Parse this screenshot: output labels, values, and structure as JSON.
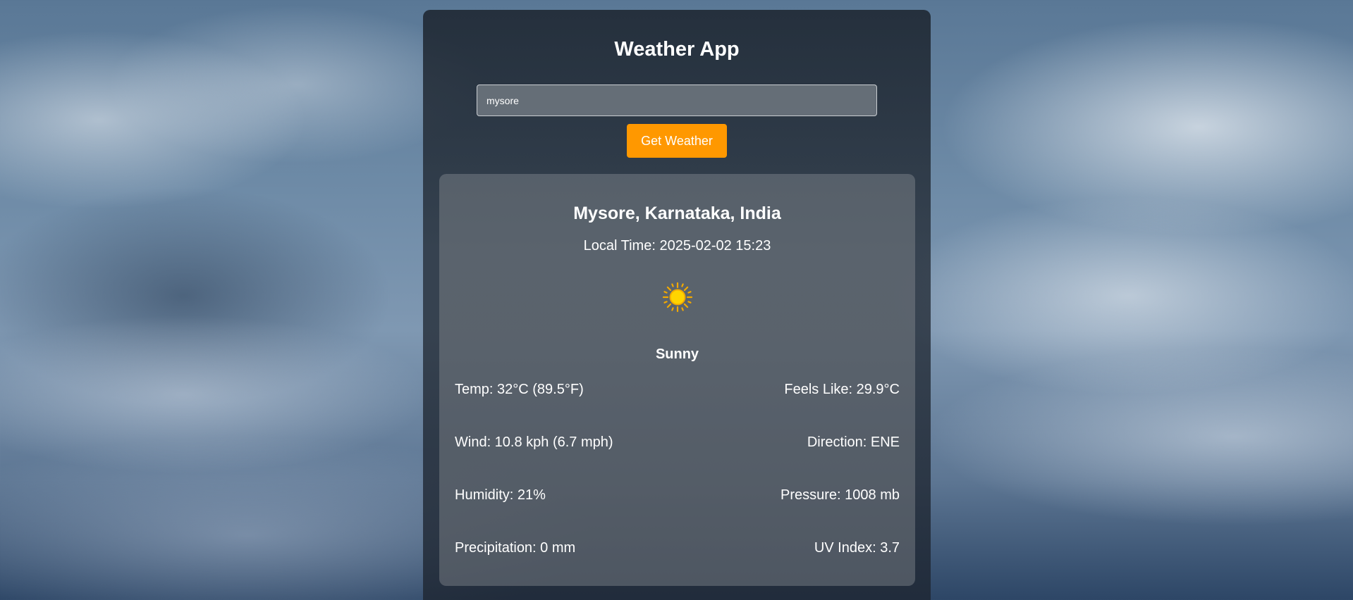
{
  "app": {
    "title": "Weather App"
  },
  "search": {
    "value": "mysore",
    "button_label": "Get Weather"
  },
  "weather": {
    "location": "Mysore, Karnataka, India",
    "local_time": "Local Time: 2025-02-02 15:23",
    "icon": "sun-icon",
    "condition": "Sunny",
    "stats": {
      "temp": "Temp: 32°C (89.5°F)",
      "feels_like": "Feels Like: 29.9°C",
      "wind": "Wind: 10.8 kph (6.7 mph)",
      "direction": "Direction: ENE",
      "humidity": "Humidity: 21%",
      "pressure": "Pressure: 1008 mb",
      "precipitation": "Precipitation: 0 mm",
      "uv_index": "UV Index: 3.7"
    }
  },
  "colors": {
    "accent": "#ff9800",
    "sun": "#ffd400",
    "sun_ray": "#f2a900"
  }
}
